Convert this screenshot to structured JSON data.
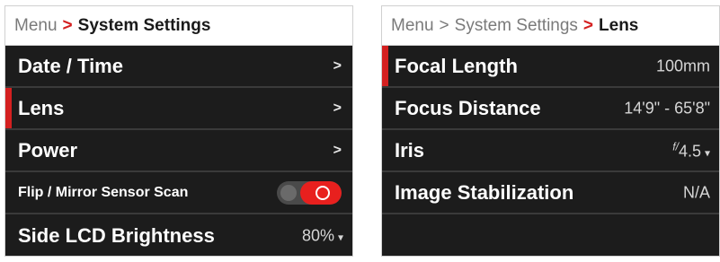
{
  "left_panel": {
    "breadcrumb": {
      "root": "Menu",
      "separator": ">",
      "current": "System Settings"
    },
    "items": [
      {
        "label": "Date / Time",
        "chevron": ">"
      },
      {
        "label": "Lens",
        "chevron": ">",
        "selected": true
      },
      {
        "label": "Power",
        "chevron": ">"
      },
      {
        "label": "Flip / Mirror Sensor Scan",
        "toggle": "on"
      },
      {
        "label": "Side LCD Brightness",
        "value": "80%",
        "dropdown": "▾"
      }
    ]
  },
  "right_panel": {
    "breadcrumb": {
      "root": "Menu",
      "separator": ">",
      "middle": "System Settings",
      "current": "Lens"
    },
    "items": [
      {
        "label": "Focal Length",
        "value": "100mm",
        "selected": true
      },
      {
        "label": "Focus Distance",
        "value": "14'9\" - 65'8\""
      },
      {
        "label": "Iris",
        "value_prefix": "f/",
        "value": "4.5",
        "dropdown": "▾"
      },
      {
        "label": "Image Stabilization",
        "value": "N/A"
      }
    ]
  },
  "colors": {
    "accent": "#d42020",
    "toggle_on": "#e8201e",
    "panel_bg": "#1c1c1c"
  }
}
